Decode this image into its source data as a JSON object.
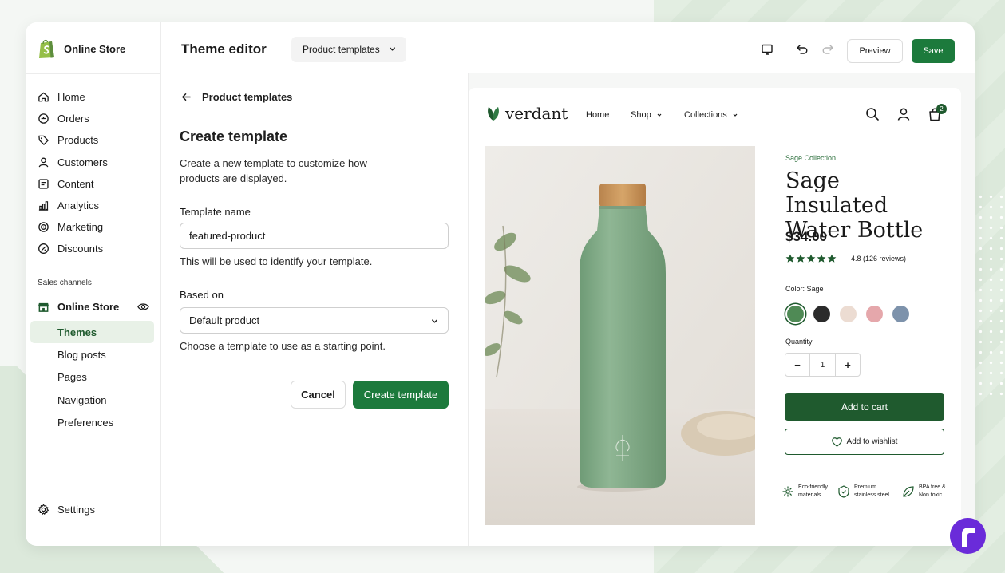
{
  "sidebar": {
    "brand": "Online Store",
    "nav": [
      {
        "label": "Home",
        "icon": "home-icon"
      },
      {
        "label": "Orders",
        "icon": "orders-icon"
      },
      {
        "label": "Products",
        "icon": "tag-icon"
      },
      {
        "label": "Customers",
        "icon": "person-icon"
      },
      {
        "label": "Content",
        "icon": "content-icon"
      },
      {
        "label": "Analytics",
        "icon": "bar-chart-icon"
      },
      {
        "label": "Marketing",
        "icon": "target-icon"
      },
      {
        "label": "Discounts",
        "icon": "discount-icon"
      }
    ],
    "sales_channels_label": "Sales channels",
    "online_store_label": "Online Store",
    "sub_items": [
      "Themes",
      "Blog posts",
      "Pages",
      "Navigation",
      "Preferences"
    ],
    "active_sub_item": "Themes",
    "settings_label": "Settings"
  },
  "topbar": {
    "title": "Theme editor",
    "template_select": "Product templates",
    "preview_label": "Preview",
    "save_label": "Save"
  },
  "form": {
    "back_label": "Product templates",
    "heading": "Create template",
    "description": "Create a new template to customize how products are displayed.",
    "name_label": "Template name",
    "name_value": "featured-product",
    "name_help": "This will be used to identify your template.",
    "based_on_label": "Based on",
    "based_on_value": "Default product",
    "based_on_help": "Choose a template to use as a starting point.",
    "cancel_label": "Cancel",
    "create_label": "Create template"
  },
  "store": {
    "logo_text": "verdant",
    "nav": {
      "home": "Home",
      "shop": "Shop",
      "collections": "Collections"
    },
    "cart_count": "2",
    "collection_label": "Sage Collection",
    "product_title": "Sage Insulated Water Bottle",
    "price": "$34.00",
    "rating_value": 4.8,
    "rating_text": "4.8 (126 reviews)",
    "color_label": "Color: Sage",
    "swatches": [
      "#4f8a55",
      "#2b2b2b",
      "#ecdcd2",
      "#e5a7ab",
      "#7d92ab"
    ],
    "selected_swatch": 0,
    "quantity_label": "Quantity",
    "quantity_value": "1",
    "add_to_cart": "Add to cart",
    "add_to_wishlist": "Add to wishlist",
    "features": [
      {
        "text": "Eco-friendly materials",
        "icon": "eco-leaf-icon"
      },
      {
        "text": "Premium stainless steel",
        "icon": "steel-badge-icon"
      },
      {
        "text": "BPA free & Non toxic",
        "icon": "leaf-check-icon"
      }
    ]
  },
  "colors": {
    "accent": "#1c7a3c",
    "store_green": "#1f5a2e",
    "badge_purple": "#6a2bd9"
  }
}
